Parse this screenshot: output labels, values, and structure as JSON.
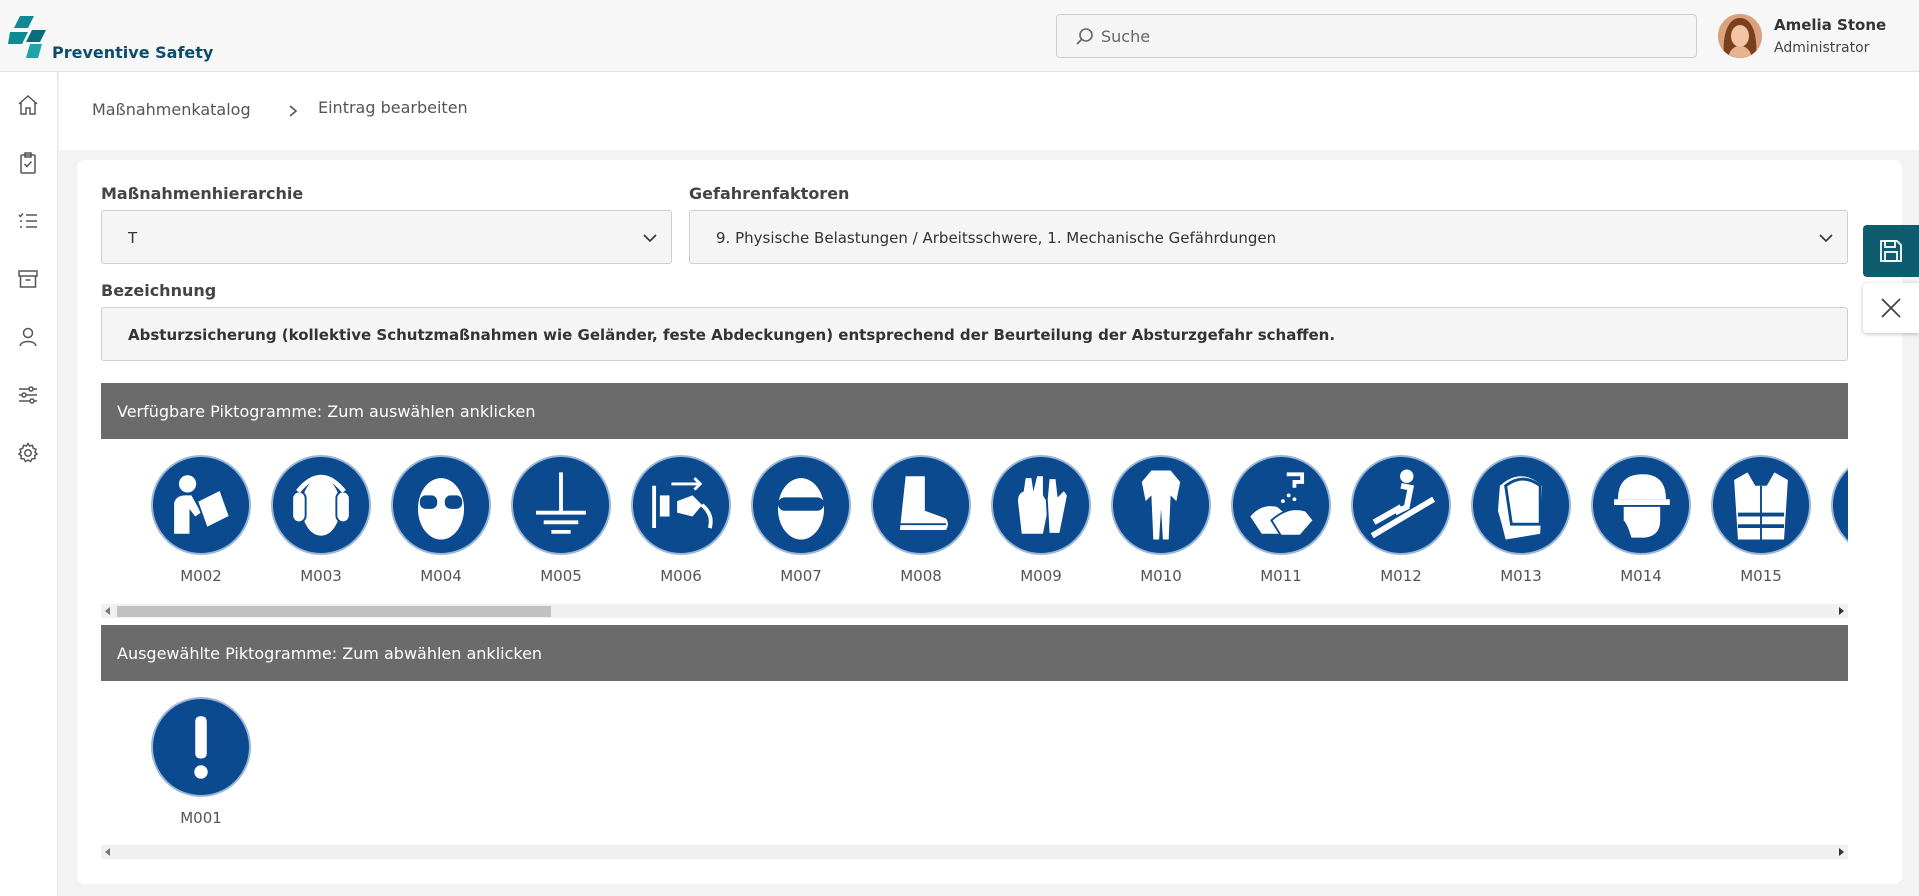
{
  "brand": {
    "name": "Preventive Safety"
  },
  "search": {
    "placeholder": "Suche"
  },
  "user": {
    "name": "Amelia Stone",
    "role": "Administrator"
  },
  "sidebar": {
    "icons": [
      "home-icon",
      "clipboard-check-icon",
      "checklist-icon",
      "archive-icon",
      "user-icon",
      "sliders-icon",
      "gear-icon"
    ]
  },
  "breadcrumb": {
    "parent": "Maßnahmenkatalog",
    "current": "Eintrag bearbeiten"
  },
  "form": {
    "hierarchy_label": "Maßnahmenhierarchie",
    "hierarchy_value": "T",
    "hazards_label": "Gefahrenfaktoren",
    "hazards_value": "9. Physische Belastungen / Arbeitsschwere, 1. Mechanische Gefährdungen",
    "designation_label": "Bezeichnung",
    "designation_value": "Absturzsicherung (kollektive Schutzmaßnahmen wie Geländer, feste Abdeckungen) entsprechend der Beurteilung der Absturzgefahr schaffen."
  },
  "available": {
    "title": "Verfügbare Piktogramme: Zum auswählen anklicken",
    "items": [
      {
        "code": "M002",
        "icon": "read-manual-icon"
      },
      {
        "code": "M003",
        "icon": "ear-protection-icon"
      },
      {
        "code": "M004",
        "icon": "eye-protection-icon"
      },
      {
        "code": "M005",
        "icon": "ground-terminal-icon"
      },
      {
        "code": "M006",
        "icon": "disconnect-plug-icon"
      },
      {
        "code": "M007",
        "icon": "opaque-eye-protection-icon"
      },
      {
        "code": "M008",
        "icon": "safety-footwear-icon"
      },
      {
        "code": "M009",
        "icon": "protective-gloves-icon"
      },
      {
        "code": "M010",
        "icon": "protective-clothing-icon"
      },
      {
        "code": "M011",
        "icon": "wash-hands-icon"
      },
      {
        "code": "M012",
        "icon": "use-handrail-icon"
      },
      {
        "code": "M013",
        "icon": "face-shield-icon"
      },
      {
        "code": "M014",
        "icon": "head-protection-icon"
      },
      {
        "code": "M015",
        "icon": "high-visibility-clothing-icon"
      }
    ]
  },
  "selected": {
    "title": "Ausgewählte Piktogramme: Zum abwählen anklicken",
    "items": [
      {
        "code": "M001",
        "icon": "general-mandatory-icon"
      }
    ]
  },
  "colors": {
    "pictogram_blue": "#0b4a8e",
    "panel_header": "#6b6b6b",
    "save_button": "#0d5d6f",
    "brand": "#0d4d6b"
  }
}
